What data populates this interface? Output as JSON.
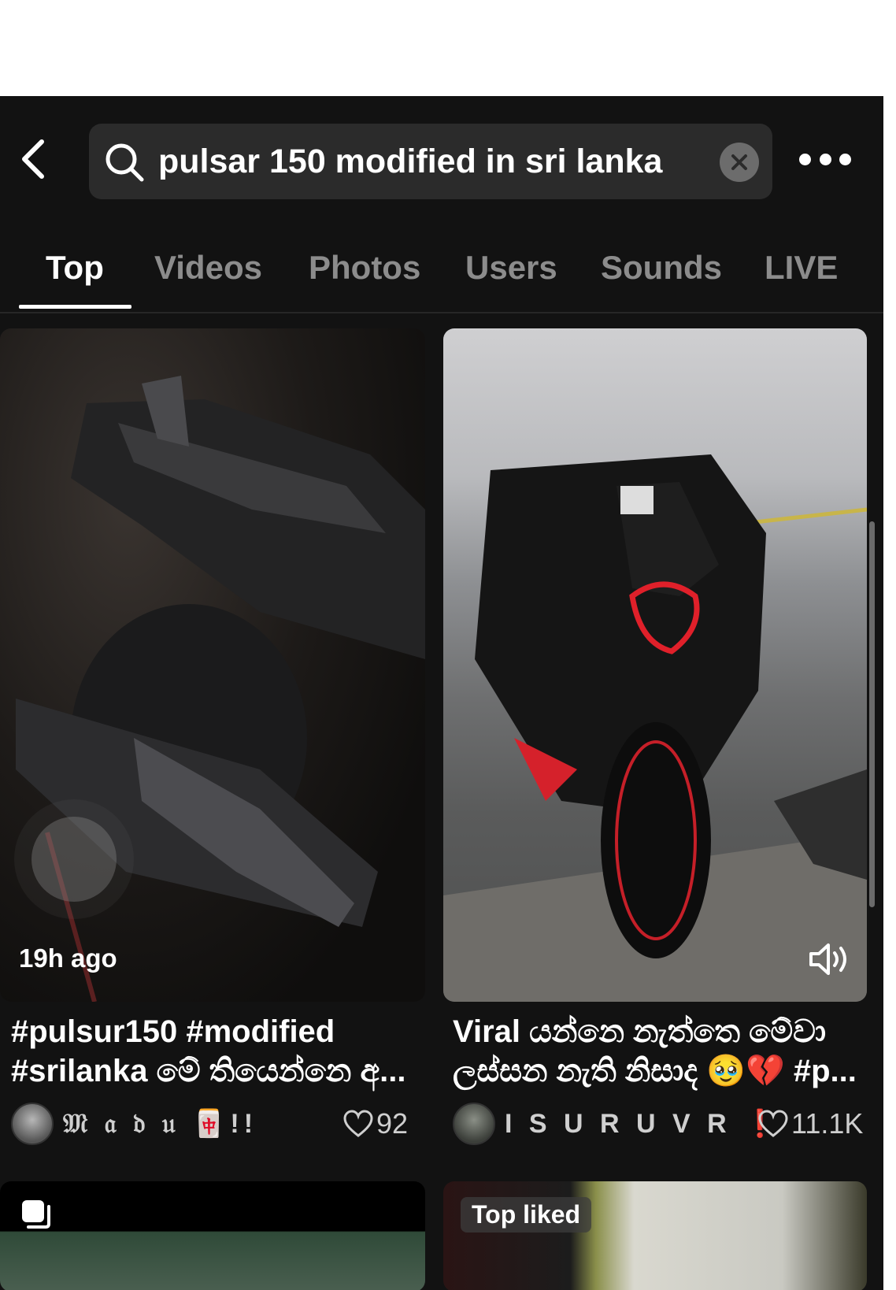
{
  "search": {
    "query": "pulsar 150 modified in sri lanka"
  },
  "tabs": [
    {
      "label": "Top",
      "active": true
    },
    {
      "label": "Videos"
    },
    {
      "label": "Photos"
    },
    {
      "label": "Users"
    },
    {
      "label": "Sounds"
    },
    {
      "label": "LIVE"
    }
  ],
  "results": [
    {
      "time_label": "19h ago",
      "caption_line1": "#pulsur150 #modified",
      "caption_line2": "#srilanka මේ තියෙන්නෙ අ...",
      "author": "𝔐 𝔞 𝔡 𝔲 🀄!!",
      "likes": "92"
    },
    {
      "caption_line1": "Viral යන්නෙ නැත්තෙ මේවා",
      "caption_line2": "ලස්සන නැති නිසාද 🥹💔 #p...",
      "author": "I S U R U  V R  ❗",
      "likes": "11.1K"
    },
    {
      "badge": ""
    },
    {
      "badge": "Top liked"
    }
  ]
}
